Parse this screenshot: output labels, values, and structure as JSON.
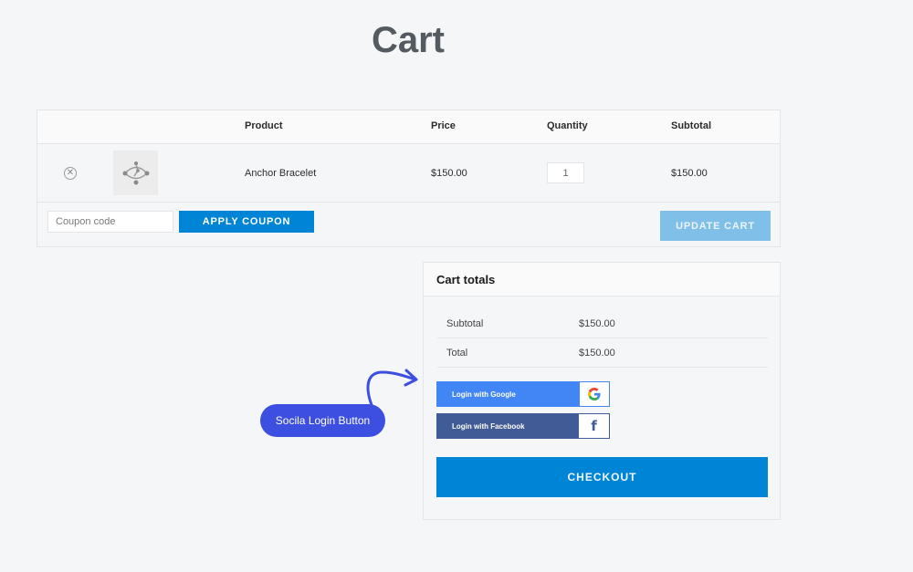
{
  "page": {
    "title": "Cart"
  },
  "cart_table": {
    "headers": {
      "product": "Product",
      "price": "Price",
      "quantity": "Quantity",
      "subtotal": "Subtotal"
    },
    "rows": [
      {
        "product": "Anchor Bracelet",
        "price": "$150.00",
        "quantity": "1",
        "subtotal": "$150.00",
        "remove_icon": "remove-circle-x-icon",
        "remove_glyph": "✕"
      }
    ],
    "coupon_placeholder": "Coupon code",
    "apply_coupon_label": "APPLY COUPON",
    "update_cart_label": "UPDATE CART"
  },
  "cart_totals": {
    "title": "Cart totals",
    "rows": [
      {
        "label": "Subtotal",
        "value": "$150.00"
      },
      {
        "label": "Total",
        "value": "$150.00"
      }
    ],
    "social_login": [
      {
        "label": "Login with Google",
        "icon": "google-icon",
        "color": "#4285f4"
      },
      {
        "label": "Login with Facebook",
        "icon": "facebook-icon",
        "glyph": "f",
        "color": "#405b95"
      }
    ],
    "checkout_label": "CHECKOUT"
  },
  "annotation": {
    "label": "Socila Login Button",
    "color": "#3c4fe0"
  },
  "colors": {
    "primary": "#0085d6",
    "primary_disabled": "#7fbfe8"
  }
}
